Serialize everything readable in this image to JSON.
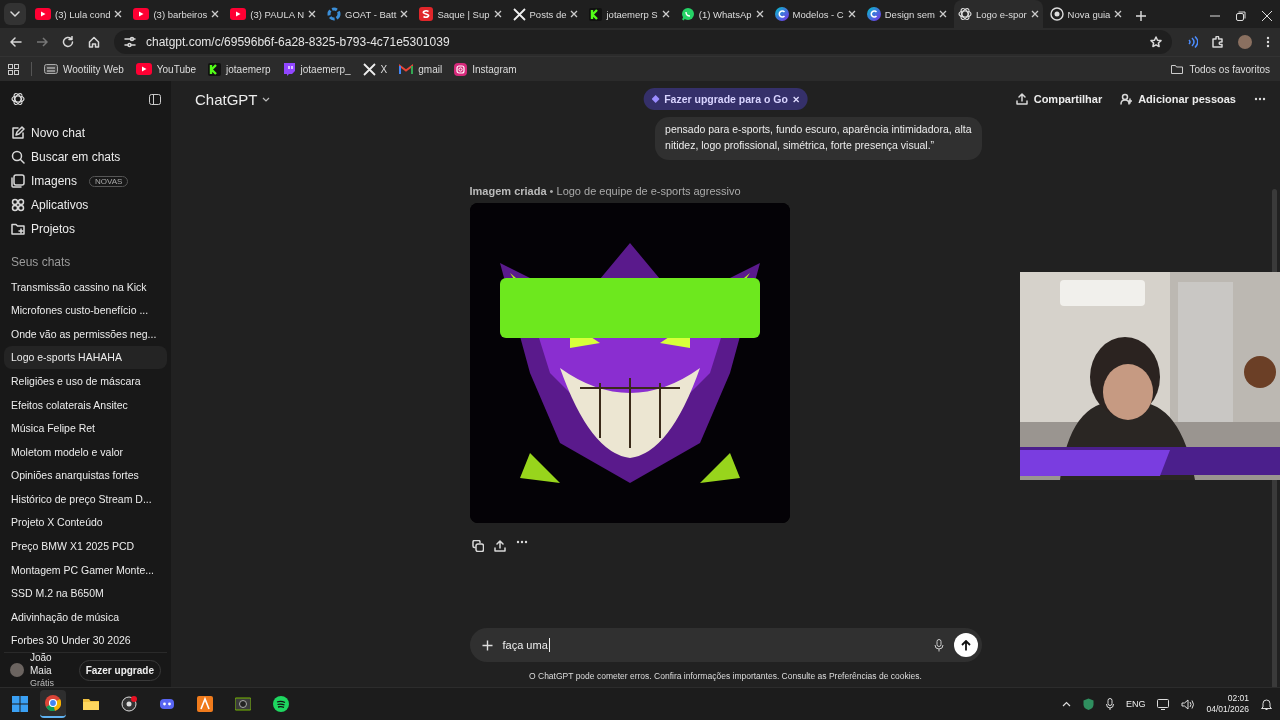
{
  "browser": {
    "tabs": [
      {
        "label": "(3) Lula cond",
        "kind": "youtube",
        "selected": false
      },
      {
        "label": "(3) barbeiros",
        "kind": "youtube",
        "selected": false
      },
      {
        "label": "(3) PAULA N",
        "kind": "youtube",
        "selected": false
      },
      {
        "label": "GOAT - Batt",
        "kind": "ring",
        "selected": false
      },
      {
        "label": "Saque | Sup",
        "kind": "square",
        "selected": false
      },
      {
        "label": "Posts de",
        "kind": "x",
        "selected": false
      },
      {
        "label": "jotaemerp S",
        "kind": "kick",
        "selected": false
      },
      {
        "label": "(1) WhatsAp",
        "kind": "chat",
        "selected": false
      },
      {
        "label": "Modelos - C",
        "kind": "canva",
        "selected": false
      },
      {
        "label": "Design sem",
        "kind": "canva",
        "selected": false
      },
      {
        "label": "Logo e-spor",
        "kind": "knot",
        "selected": true
      },
      {
        "label": "Nova guia",
        "kind": "globe",
        "selected": false
      }
    ],
    "address": "chatgpt.com/c/69596b6f-6a28-8325-b793-4c71e5301039",
    "bookmarks": [
      {
        "label": "Wootility Web",
        "kind": "keyboard"
      },
      {
        "label": "YouTube",
        "kind": "youtube"
      },
      {
        "label": "jotaemerp",
        "kind": "kick"
      },
      {
        "label": "jotaemerp_",
        "kind": "twitch"
      },
      {
        "label": "X",
        "kind": "x"
      },
      {
        "label": "gmail",
        "kind": "mail"
      },
      {
        "label": "Instagram",
        "kind": "camera"
      }
    ],
    "all_bookmarks": "Todos os favoritos"
  },
  "sidebar": {
    "nav": [
      {
        "label": "Novo chat",
        "kind": "edit"
      },
      {
        "label": "Buscar em chats",
        "kind": "search"
      },
      {
        "label": "Imagens",
        "kind": "images",
        "badge": "NOVAS"
      },
      {
        "label": "Aplicativos",
        "kind": "apps"
      },
      {
        "label": "Projetos",
        "kind": "folder"
      }
    ],
    "section_title": "Seus chats",
    "chats": [
      {
        "label": "Transmissão cassino na Kick",
        "selected": false
      },
      {
        "label": "Microfones custo-benefício ...",
        "selected": false
      },
      {
        "label": "Onde vão as permissões neg...",
        "selected": false
      },
      {
        "label": "Logo e-sports HAHAHA",
        "selected": true
      },
      {
        "label": "Religiões e uso de máscara",
        "selected": false
      },
      {
        "label": "Efeitos colaterais Ansitec",
        "selected": false
      },
      {
        "label": "Música Felipe Ret",
        "selected": false
      },
      {
        "label": "Moletom modelo e valor",
        "selected": false
      },
      {
        "label": "Opiniões anarquistas fortes",
        "selected": false
      },
      {
        "label": "Histórico de preço Stream D...",
        "selected": false
      },
      {
        "label": "Projeto X Conteúdo",
        "selected": false
      },
      {
        "label": "Preço BMW X1 2025 PCD",
        "selected": false
      },
      {
        "label": "Montagem PC Gamer Monte...",
        "selected": false
      },
      {
        "label": "SSD M.2 na B650M",
        "selected": false
      },
      {
        "label": "Adivinhação de música",
        "selected": false
      },
      {
        "label": "Forbes 30 Under 30 2026",
        "selected": false
      }
    ],
    "user": {
      "name": "João Maia",
      "plan": "Grátis"
    },
    "upgrade_button": "Fazer upgrade"
  },
  "header": {
    "title": "ChatGPT",
    "promo": "Fazer upgrade para o Go",
    "actions": [
      {
        "label": "Compartilhar",
        "kind": "share"
      },
      {
        "label": "Adicionar pessoas",
        "kind": "person-add"
      }
    ]
  },
  "conversation": {
    "user_message": [
      "pensado para e-sports, fundo escuro, aparência intimidadora, alta",
      "nitidez, logo profissional, simétrica, forte presença visual.”"
    ],
    "image_status": "Imagem criada",
    "image_separator": "•",
    "image_title": "Logo de equipe de e-sports agressivo"
  },
  "composer": {
    "value": "faça uma",
    "disclaimer": "O ChatGPT pode cometer erros. Confira informações importantes. Consulte as ",
    "cookie_link": "Preferências de cookies",
    "disclaimer_end": "."
  },
  "taskbar": {
    "apps": [
      {
        "kind": "chrome",
        "selected": true
      },
      {
        "kind": "files",
        "selected": false
      },
      {
        "kind": "obs",
        "selected": false
      },
      {
        "kind": "discord",
        "selected": false
      },
      {
        "kind": "vector",
        "selected": false
      },
      {
        "kind": "gpu",
        "selected": false
      },
      {
        "kind": "music",
        "selected": false
      }
    ],
    "language": "ENG",
    "time": "02:01",
    "date": "04/01/2026"
  }
}
